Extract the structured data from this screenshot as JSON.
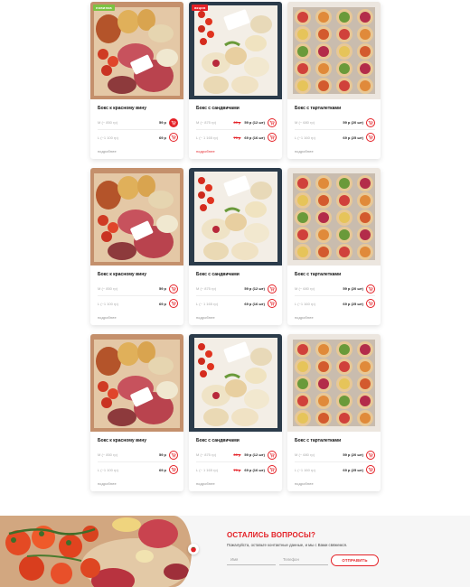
{
  "products": [
    {
      "badge": "новинка",
      "badge_type": "new",
      "image": "wine-box",
      "title": "Бокс к красному вину",
      "variants": [
        {
          "weight": "M (~ 850 гр)",
          "old": "",
          "price": "59 р",
          "cart_filled": true
        },
        {
          "weight": "L (~1 100 гр)",
          "old": "",
          "price": "69 р",
          "cart_filled": false
        }
      ],
      "more": "подробнее",
      "more_red": false
    },
    {
      "badge": "акция",
      "badge_type": "sale",
      "image": "sandwich-box",
      "title": "Бокс с сандвичами",
      "variants": [
        {
          "weight": "M (~ 875 гр)",
          "old": "69 р",
          "price": "59 р (12 шт)",
          "cart_filled": false
        },
        {
          "weight": "L (~ 1 165 гр)",
          "old": "79 р",
          "price": "69 р (16 шт)",
          "cart_filled": false
        }
      ],
      "more": "подробнее",
      "more_red": true
    },
    {
      "badge": "",
      "badge_type": "",
      "image": "tartlet-box",
      "title": "Бокс с тарталетками",
      "variants": [
        {
          "weight": "M (~ 680 гр)",
          "old": "",
          "price": "59 р (20 шт)",
          "cart_filled": false
        },
        {
          "weight": "L (~1 160 гр)",
          "old": "",
          "price": "69 р (25 шт)",
          "cart_filled": false
        }
      ],
      "more": "подробнее",
      "more_red": false
    },
    {
      "badge": "",
      "badge_type": "",
      "image": "wine-box",
      "title": "Бокс к красному вину",
      "variants": [
        {
          "weight": "M (~ 850 гр)",
          "old": "",
          "price": "59 р",
          "cart_filled": false
        },
        {
          "weight": "L (~1 100 гр)",
          "old": "",
          "price": "69 р",
          "cart_filled": false
        }
      ],
      "more": "подробнее",
      "more_red": false
    },
    {
      "badge": "",
      "badge_type": "",
      "image": "sandwich-box",
      "title": "Бокс с сандвичами",
      "variants": [
        {
          "weight": "M (~ 875 гр)",
          "old": "",
          "price": "59 р (12 шт)",
          "cart_filled": false
        },
        {
          "weight": "L (~ 1 165 гр)",
          "old": "",
          "price": "69 р (16 шт)",
          "cart_filled": false
        }
      ],
      "more": "подробнее",
      "more_red": false
    },
    {
      "badge": "",
      "badge_type": "",
      "image": "tartlet-box",
      "title": "Бокс с тарталетками",
      "variants": [
        {
          "weight": "M (~ 680 гр)",
          "old": "",
          "price": "59 р (20 шт)",
          "cart_filled": false
        },
        {
          "weight": "L (~1 160 гр)",
          "old": "",
          "price": "69 р (25 шт)",
          "cart_filled": false
        }
      ],
      "more": "подробнее",
      "more_red": false
    },
    {
      "badge": "",
      "badge_type": "",
      "image": "wine-box",
      "title": "Бокс к красному вину",
      "variants": [
        {
          "weight": "M (~ 850 гр)",
          "old": "",
          "price": "59 р",
          "cart_filled": false
        },
        {
          "weight": "L (~1 100 гр)",
          "old": "",
          "price": "69 р",
          "cart_filled": false
        }
      ],
      "more": "подробнее",
      "more_red": false
    },
    {
      "badge": "",
      "badge_type": "",
      "image": "sandwich-box",
      "title": "Бокс с сандвичами",
      "variants": [
        {
          "weight": "M (~ 875 гр)",
          "old": "69 р",
          "price": "59 р (12 шт)",
          "cart_filled": false
        },
        {
          "weight": "L (~ 1 165 гр)",
          "old": "79 р",
          "price": "69 р (16 шт)",
          "cart_filled": false
        }
      ],
      "more": "подробнее",
      "more_red": false
    },
    {
      "badge": "",
      "badge_type": "",
      "image": "tartlet-box",
      "title": "Бокс с тарталетками",
      "variants": [
        {
          "weight": "M (~ 680 гр)",
          "old": "",
          "price": "59 р (20 шт)",
          "cart_filled": false
        },
        {
          "weight": "L (~1 160 гр)",
          "old": "",
          "price": "69 р (25 шт)",
          "cart_filled": false
        }
      ],
      "more": "подробнее",
      "more_red": false
    }
  ],
  "icons": {
    "cart": "cart-icon"
  },
  "colors": {
    "accent": "#e42026",
    "new_badge": "#7cc242"
  },
  "contact": {
    "title": "ОСТАЛИСЬ ВОПРОСЫ?",
    "subtitle": "Пожалуйста, оставьте контактные данные, и мы с Вами свяжемся.",
    "name_placeholder": "Имя",
    "phone_placeholder": "Телефон",
    "submit_label": "ОТПРАВИТЬ",
    "image": "charcuterie-photo"
  }
}
